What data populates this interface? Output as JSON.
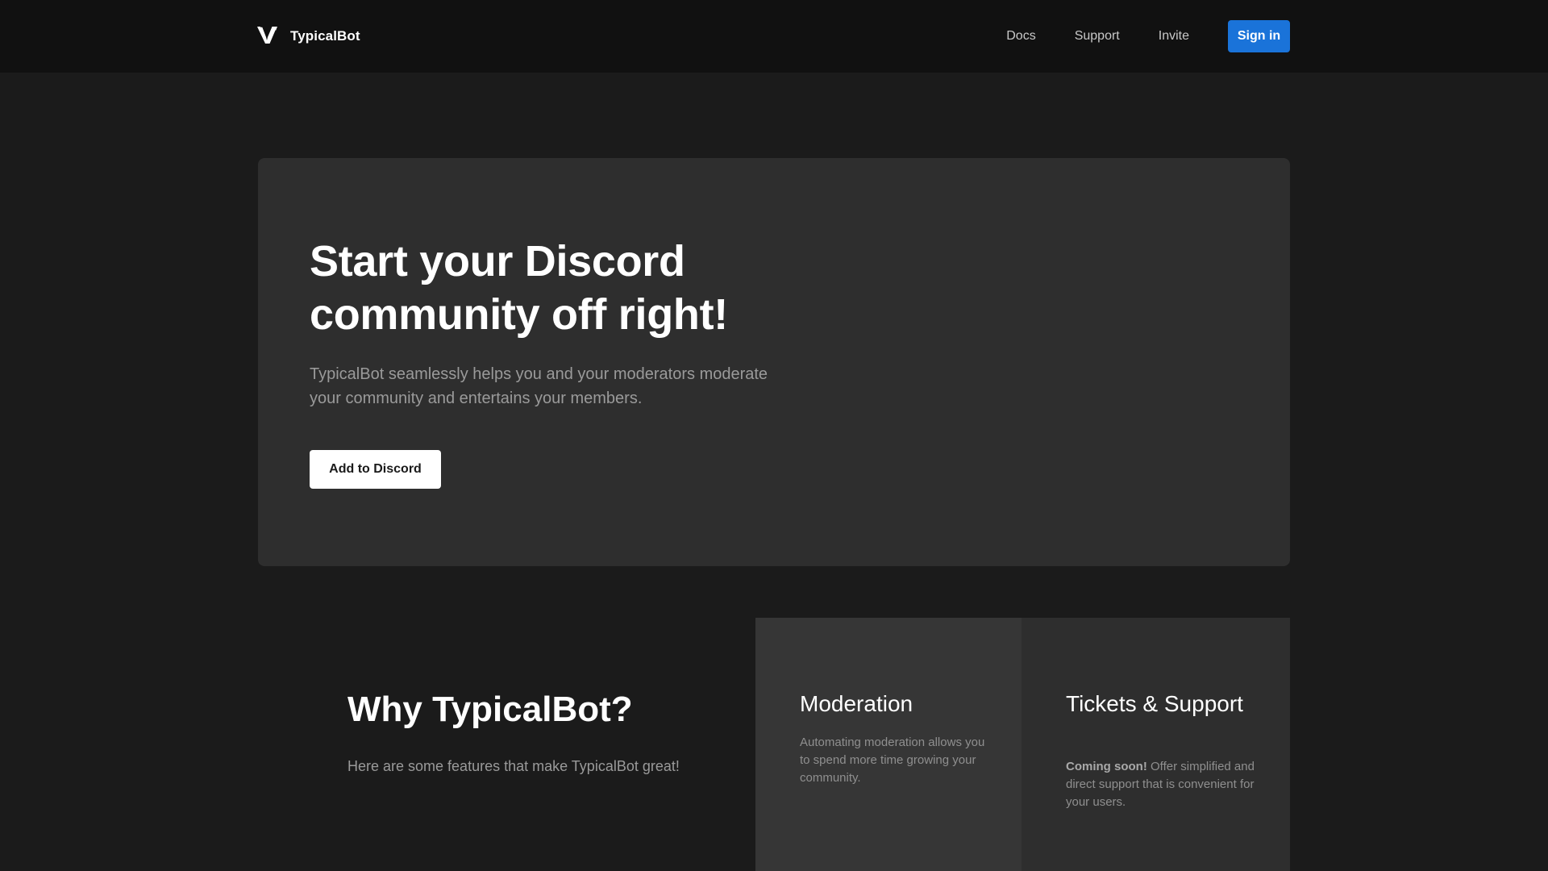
{
  "header": {
    "brand_name": "TypicalBot",
    "logo_icon": "typicalbot-logo-icon",
    "nav": [
      {
        "label": "Docs"
      },
      {
        "label": "Support"
      },
      {
        "label": "Invite"
      }
    ],
    "signin_label": "Sign in",
    "accent_color": "#1a73d9"
  },
  "hero": {
    "title": "Start your Discord community off right!",
    "description": "TypicalBot seamlessly helps you and your moderators moderate your community and entertains your members.",
    "cta_label": "Add to Discord"
  },
  "why": {
    "title": "Why TypicalBot?",
    "description": "Here are some features that make TypicalBot great!"
  },
  "features": [
    {
      "title": "Moderation",
      "text": "Automating moderation allows you to spend more time growing your community."
    },
    {
      "title": "Tickets & Support",
      "badge": "Coming soon!",
      "text": "Offer simplified and direct support that is convenient for your users."
    }
  ]
}
